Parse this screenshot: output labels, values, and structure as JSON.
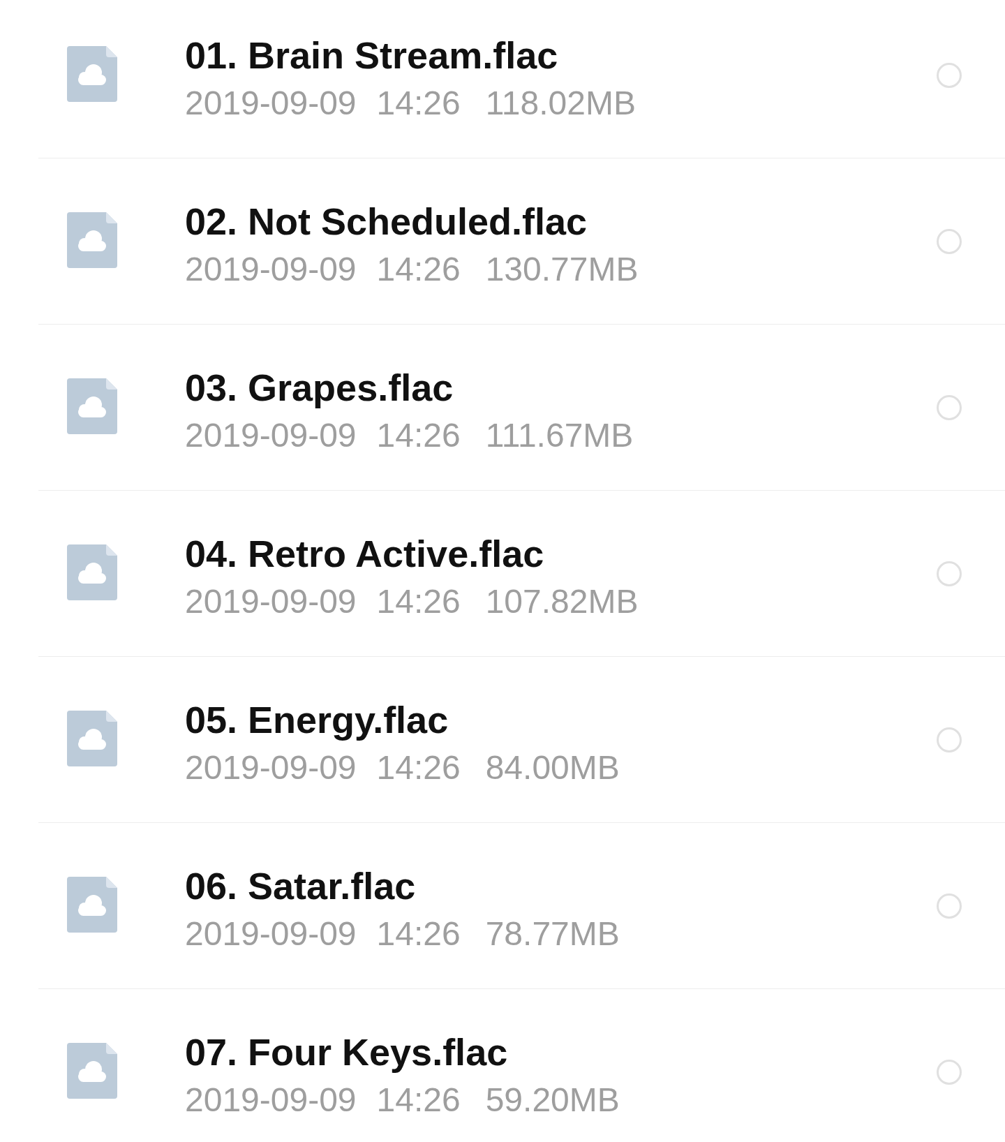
{
  "files": [
    {
      "name": "01. Brain Stream.flac",
      "date": "2019-09-09",
      "time": "14:26",
      "size": "118.02MB",
      "selected": false
    },
    {
      "name": "02. Not Scheduled.flac",
      "date": "2019-09-09",
      "time": "14:26",
      "size": "130.77MB",
      "selected": false
    },
    {
      "name": "03. Grapes.flac",
      "date": "2019-09-09",
      "time": "14:26",
      "size": "111.67MB",
      "selected": false
    },
    {
      "name": "04. Retro Active.flac",
      "date": "2019-09-09",
      "time": "14:26",
      "size": "107.82MB",
      "selected": false
    },
    {
      "name": "05. Energy.flac",
      "date": "2019-09-09",
      "time": "14:26",
      "size": "84.00MB",
      "selected": false
    },
    {
      "name": "06. Satar.flac",
      "date": "2019-09-09",
      "time": "14:26",
      "size": "78.77MB",
      "selected": false
    },
    {
      "name": "07. Four Keys.flac",
      "date": "2019-09-09",
      "time": "14:26",
      "size": "59.20MB",
      "selected": false
    }
  ]
}
